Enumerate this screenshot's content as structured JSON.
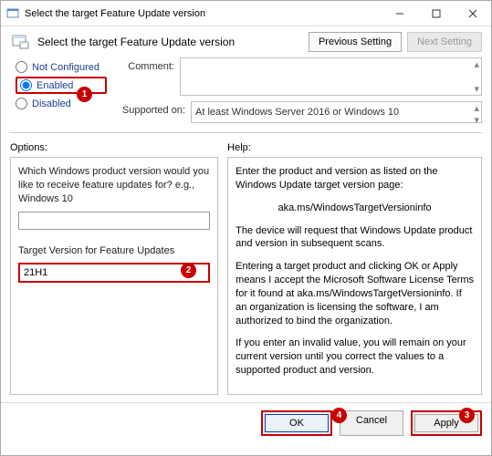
{
  "window": {
    "title": "Select the target Feature Update version"
  },
  "header": {
    "title": "Select the target Feature Update version",
    "prev_btn": "Previous Setting",
    "next_btn": "Next Setting"
  },
  "radios": {
    "not_configured": "Not Configured",
    "enabled": "Enabled",
    "disabled": "Disabled"
  },
  "labels": {
    "comment": "Comment:",
    "supported_on": "Supported on:",
    "options": "Options:",
    "help": "Help:"
  },
  "supported_text": "At least Windows Server 2016 or Windows 10",
  "options_panel": {
    "question": "Which Windows product version would you like to receive feature updates for? e.g., Windows 10",
    "product_value": "",
    "target_label": "Target Version for Feature Updates",
    "target_value": "21H1"
  },
  "help_panel": {
    "p1": "Enter the product and version as listed on the Windows Update target version page:",
    "p2": "aka.ms/WindowsTargetVersioninfo",
    "p3": "The device will request that Windows Update product and version in subsequent scans.",
    "p4": "Entering a target product and clicking OK or Apply means I accept the Microsoft Software License Terms for it found at aka.ms/WindowsTargetVersioninfo. If an organization is licensing the software, I am authorized to bind the organization.",
    "p5": "If you enter an invalid value, you will remain on your current version until you correct the values to a supported product and version."
  },
  "footer": {
    "ok": "OK",
    "cancel": "Cancel",
    "apply": "Apply"
  },
  "badges": {
    "b1": "1",
    "b2": "2",
    "b3": "3",
    "b4": "4"
  }
}
